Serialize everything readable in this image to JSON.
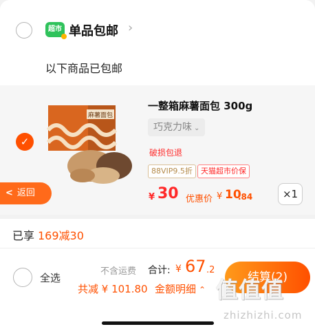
{
  "shop": {
    "logo_text": "超市",
    "title": "单品包邮",
    "arrow": "›",
    "note": "以下商品已包邮"
  },
  "product": {
    "title": "一整箱麻薯面包 300g",
    "sku": "巧克力味",
    "tag_return": "破损包退",
    "tag_vip": "88VIP9.5折",
    "tag_tmall": "天猫超市价保",
    "currency": "¥",
    "price": "30",
    "discount_label": "优惠价",
    "discount_int": "10",
    "discount_dec": ".84",
    "quantity": "×1",
    "image_text": "麻薯面包"
  },
  "back_button": {
    "label": "返回"
  },
  "promo": {
    "prefix": "已享",
    "value": "169减30"
  },
  "footer": {
    "select_all": "全选",
    "shipping_note": "不含运费",
    "total_label": "合计:",
    "total_symbol": "¥",
    "total_int": "67",
    "total_dec": ".2",
    "saved": "共减 ¥ 101.80",
    "detail": "金额明细",
    "checkout": "结算(2)"
  },
  "watermark": {
    "logo": "值值值",
    "url": "zhizhizhi.com"
  },
  "colors": {
    "accent": "#ff5000",
    "price_red": "#ff2a2a",
    "chaoshi_green": "#2fc25b",
    "back_orange": "#ff6a1a"
  }
}
